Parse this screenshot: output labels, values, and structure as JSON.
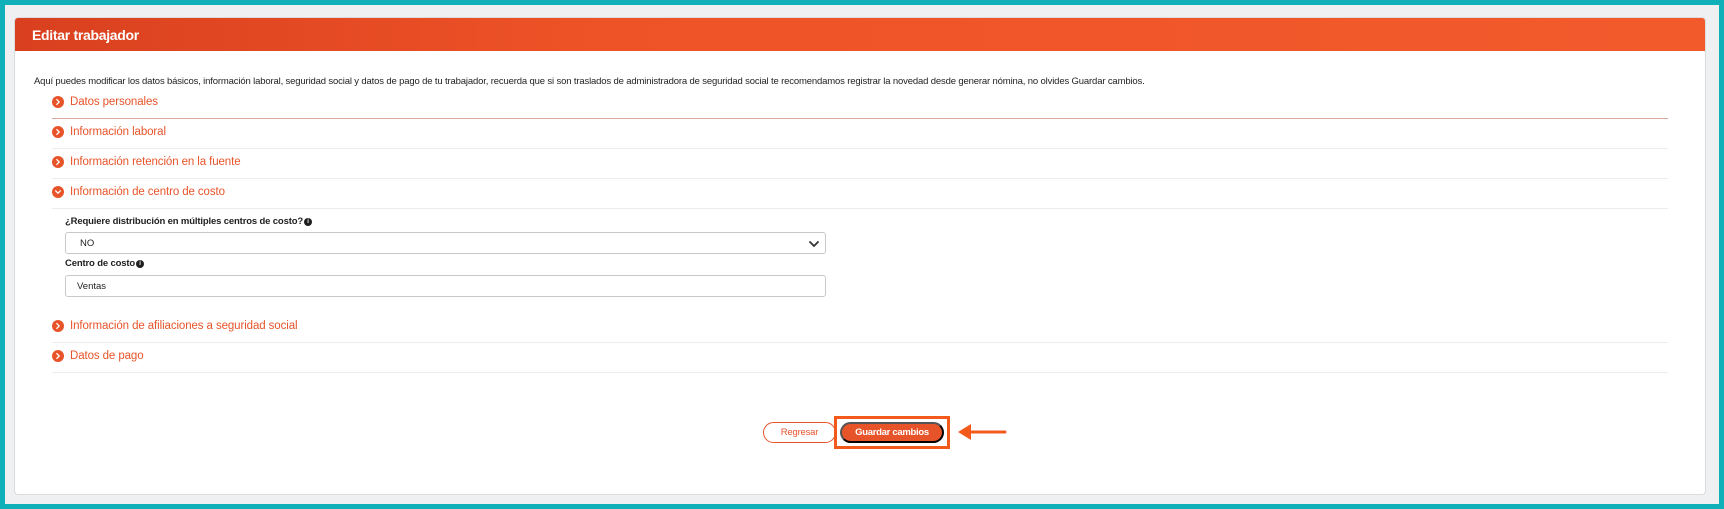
{
  "header": {
    "title": "Editar trabajador"
  },
  "intro": "Aquí puedes modificar los datos básicos, información laboral, seguridad social y datos de pago de tu trabajador, recuerda que si son traslados de administradora de seguridad social te recomendamos registrar la novedad desde generar nómina, no olvides Guardar cambios.",
  "sections": [
    {
      "label": "Datos personales",
      "expanded": false
    },
    {
      "label": "Información laboral",
      "expanded": false
    },
    {
      "label": "Información retención en la fuente",
      "expanded": false
    },
    {
      "label": "Información de centro de costo",
      "expanded": true
    },
    {
      "label": "Información de afiliaciones a seguridad social",
      "expanded": false
    },
    {
      "label": "Datos de pago",
      "expanded": false
    }
  ],
  "cost_center": {
    "distribution_label": "¿Requiere distribución en múltiples centros de costo?",
    "distribution_value": "NO",
    "center_label": "Centro de costo",
    "center_value": "Ventas"
  },
  "actions": {
    "back_label": "Regresar",
    "save_label": "Guardar cambios"
  },
  "colors": {
    "accent": "#e8542a",
    "frame": "#0fb0b8",
    "highlight": "#f25a1c"
  }
}
